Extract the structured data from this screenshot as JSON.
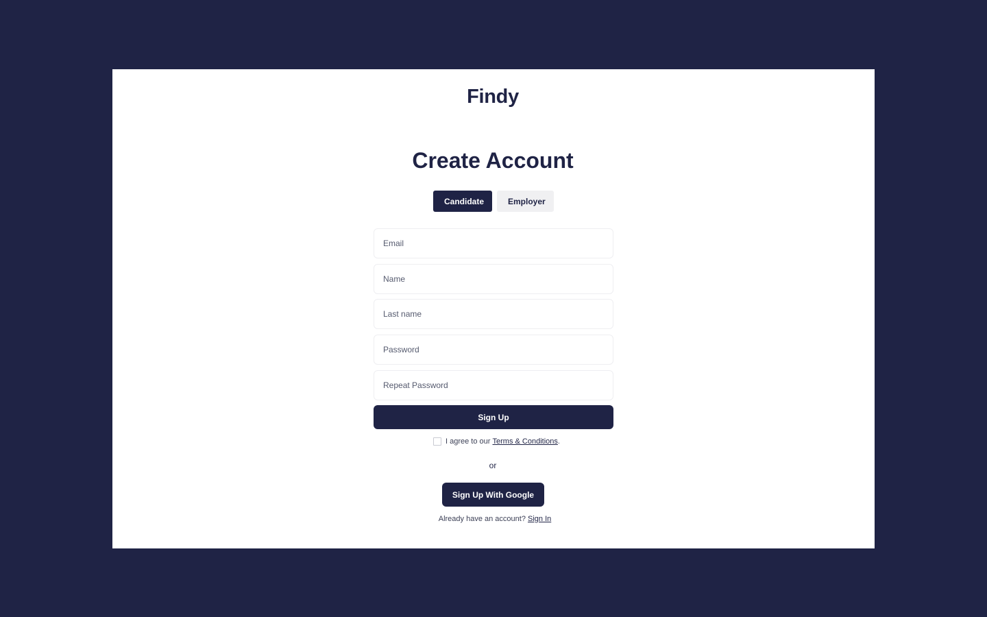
{
  "brand": {
    "name": "Findy"
  },
  "form": {
    "title": "Create Account",
    "roles": [
      {
        "label": "Candidate",
        "selected": true
      },
      {
        "label": "Employer",
        "selected": false
      }
    ],
    "fields": {
      "email": {
        "placeholder": "Email",
        "value": ""
      },
      "name": {
        "placeholder": "Name",
        "value": ""
      },
      "last_name": {
        "placeholder": "Last name",
        "value": ""
      },
      "password": {
        "placeholder": "Password",
        "value": ""
      },
      "repeat_password": {
        "placeholder": "Repeat Password",
        "value": ""
      }
    },
    "submit_label": "Sign Up",
    "terms": {
      "prefix": "I agree to our ",
      "link_label": "Terms & Conditions",
      "suffix": ".",
      "checked": false
    },
    "separator": "or",
    "google_label": "Sign Up With Google",
    "signin": {
      "prompt": "Already have an account? ",
      "link_label": "Sign In"
    }
  },
  "colors": {
    "background": "#1f2345",
    "surface": "#ffffff",
    "primary": "#1f2345",
    "inactive_tab": "#f0f0f2"
  }
}
